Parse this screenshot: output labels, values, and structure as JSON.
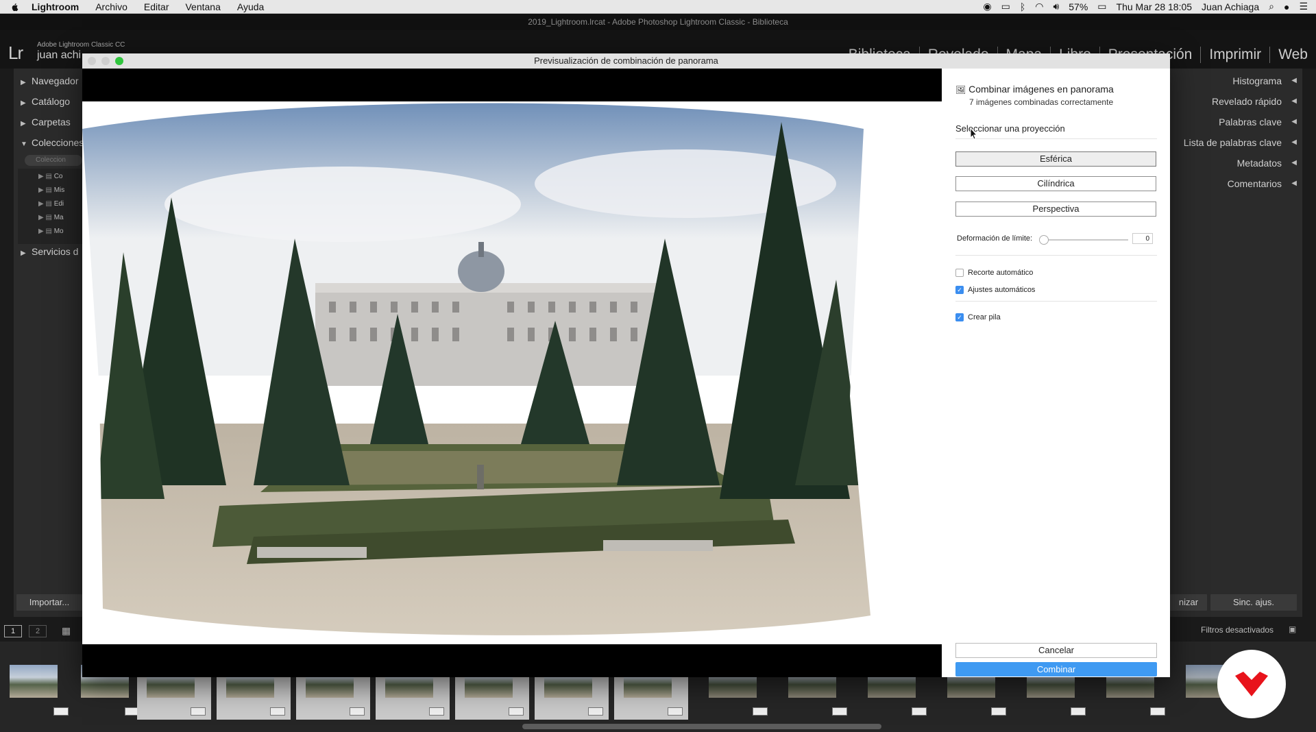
{
  "menubar": {
    "app": "Lightroom",
    "items": [
      "Archivo",
      "Editar",
      "Ventana",
      "Ayuda"
    ],
    "battery": "57%",
    "datetime": "Thu Mar 28  18:05",
    "user": "Juan Achiaga"
  },
  "window": {
    "title": "2019_Lightroom.lrcat - Adobe Photoshop Lightroom Classic - Biblioteca"
  },
  "lightroom": {
    "logo": "Lr",
    "product": "Adobe Lightroom Classic CC",
    "user": "juan achi",
    "modules": [
      "Biblioteca",
      "Revelado",
      "Mapa",
      "Libro",
      "Presentación",
      "Imprimir",
      "Web"
    ]
  },
  "left_panel": {
    "items": [
      "Navegador",
      "Catálogo",
      "Carpetas",
      "Colecciones",
      "Servicios d"
    ],
    "collections_search": "Coleccion",
    "collections": [
      "Co",
      "Mis",
      "Edi",
      "Ma",
      "Mo"
    ],
    "import_button": "Importar..."
  },
  "right_panel": {
    "items": [
      "Histograma",
      "Revelado rápido",
      "Palabras clave",
      "Lista de palabras clave",
      "Metadatos",
      "Comentarios"
    ],
    "sync_partial": "nizar",
    "sync_button": "Sinc. ajus."
  },
  "filmstrip": {
    "view_buttons": [
      "1",
      "2"
    ],
    "filter_label": "Filtros desactivados"
  },
  "dialog": {
    "title": "Previsualización de combinación de panorama",
    "panel": {
      "title": "Combinar imágenes en panorama",
      "subtitle": "7 imágenes combinadas correctamente",
      "projection_heading": "Seleccionar una proyección",
      "projections": [
        "Esférica",
        "Cilíndrica",
        "Perspectiva"
      ],
      "active_projection": "Esférica",
      "boundary_label": "Deformación de límite:",
      "boundary_value": "0",
      "auto_crop_label": "Recorte automático",
      "auto_crop": false,
      "auto_settings_label": "Ajustes automáticos",
      "auto_settings": true,
      "create_stack_label": "Crear pila",
      "create_stack": true,
      "cancel": "Cancelar",
      "combine": "Combinar"
    }
  },
  "colors": {
    "accent": "#3f9af2",
    "brand_red": "#e8131b"
  }
}
